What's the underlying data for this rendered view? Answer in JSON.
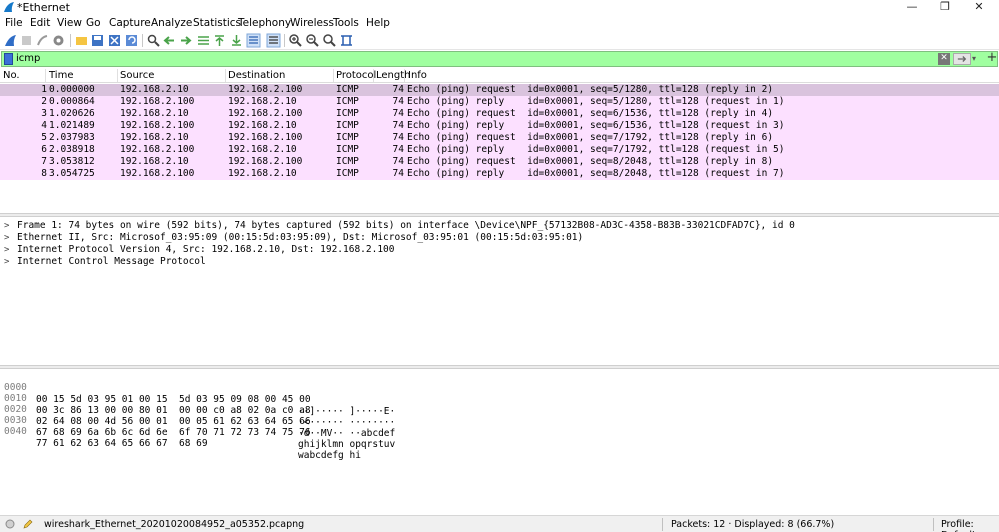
{
  "window": {
    "title": "*Ethernet",
    "minimize": "—",
    "maximize": "❐",
    "close": "✕"
  },
  "menu": [
    "File",
    "Edit",
    "View",
    "Go",
    "Capture",
    "Analyze",
    "Statistics",
    "Telephony",
    "Wireless",
    "Tools",
    "Help"
  ],
  "filter": {
    "value": "icmp",
    "clear": "✕",
    "dropdown": "▾",
    "add": "+"
  },
  "columns": [
    "No.",
    "Time",
    "Source",
    "Destination",
    "Protocol",
    "Length",
    "Info"
  ],
  "packets": [
    {
      "no": "1",
      "time": "0.000000",
      "src": "192.168.2.10",
      "dst": "192.168.2.100",
      "proto": "ICMP",
      "len": "74",
      "info": "Echo (ping) request  id=0x0001, seq=5/1280, ttl=128 (reply in 2)"
    },
    {
      "no": "2",
      "time": "0.000864",
      "src": "192.168.2.100",
      "dst": "192.168.2.10",
      "proto": "ICMP",
      "len": "74",
      "info": "Echo (ping) reply    id=0x0001, seq=5/1280, ttl=128 (request in 1)"
    },
    {
      "no": "3",
      "time": "1.020626",
      "src": "192.168.2.10",
      "dst": "192.168.2.100",
      "proto": "ICMP",
      "len": "74",
      "info": "Echo (ping) request  id=0x0001, seq=6/1536, ttl=128 (reply in 4)"
    },
    {
      "no": "4",
      "time": "1.021489",
      "src": "192.168.2.100",
      "dst": "192.168.2.10",
      "proto": "ICMP",
      "len": "74",
      "info": "Echo (ping) reply    id=0x0001, seq=6/1536, ttl=128 (request in 3)"
    },
    {
      "no": "5",
      "time": "2.037983",
      "src": "192.168.2.10",
      "dst": "192.168.2.100",
      "proto": "ICMP",
      "len": "74",
      "info": "Echo (ping) request  id=0x0001, seq=7/1792, ttl=128 (reply in 6)"
    },
    {
      "no": "6",
      "time": "2.038918",
      "src": "192.168.2.100",
      "dst": "192.168.2.10",
      "proto": "ICMP",
      "len": "74",
      "info": "Echo (ping) reply    id=0x0001, seq=7/1792, ttl=128 (request in 5)"
    },
    {
      "no": "7",
      "time": "3.053812",
      "src": "192.168.2.10",
      "dst": "192.168.2.100",
      "proto": "ICMP",
      "len": "74",
      "info": "Echo (ping) request  id=0x0001, seq=8/2048, ttl=128 (reply in 8)"
    },
    {
      "no": "8",
      "time": "3.054725",
      "src": "192.168.2.100",
      "dst": "192.168.2.10",
      "proto": "ICMP",
      "len": "74",
      "info": "Echo (ping) reply    id=0x0001, seq=8/2048, ttl=128 (request in 7)"
    }
  ],
  "details": [
    "Frame 1: 74 bytes on wire (592 bits), 74 bytes captured (592 bits) on interface \\Device\\NPF_{57132B08-AD3C-4358-B83B-33021CDFAD7C}, id 0",
    "Ethernet II, Src: Microsof_03:95:09 (00:15:5d:03:95:09), Dst: Microsof_03:95:01 (00:15:5d:03:95:01)",
    "Internet Protocol Version 4, Src: 192.168.2.10, Dst: 192.168.2.100",
    "Internet Control Message Protocol"
  ],
  "bytes": [
    {
      "offset": "0000",
      "hex": "00 15 5d 03 95 01 00 15  5d 03 95 09 08 00 45 00",
      "ascii": "··]····· ]·····E·"
    },
    {
      "offset": "0010",
      "hex": "00 3c 86 13 00 00 80 01  00 00 c0 a8 02 0a c0 a8",
      "ascii": "·<······ ········"
    },
    {
      "offset": "0020",
      "hex": "02 64 08 00 4d 56 00 01  00 05 61 62 63 64 65 66",
      "ascii": "·d··MV·· ··abcdef"
    },
    {
      "offset": "0030",
      "hex": "67 68 69 6a 6b 6c 6d 6e  6f 70 71 72 73 74 75 76",
      "ascii": "ghijklmn opqrstuv"
    },
    {
      "offset": "0040",
      "hex": "77 61 62 63 64 65 66 67  68 69",
      "ascii": "wabcdefg hi"
    }
  ],
  "status": {
    "file": "wireshark_Ethernet_20201020084952_a05352.pcapng",
    "packets": "Packets: 12 · Displayed: 8 (66.7%)",
    "profile": "Profile: Default"
  },
  "colors": {
    "row_bg": "#fce0ff",
    "row_selected": "#d9c3dd",
    "filter_bg": "#a0ffa0"
  }
}
